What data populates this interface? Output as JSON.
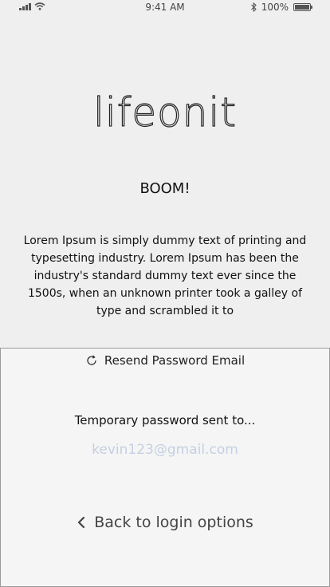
{
  "status_bar": {
    "time": "9:41 AM",
    "battery_text": "100%",
    "icons": [
      "signal-icon",
      "wifi-icon",
      "bluetooth-icon",
      "battery-icon"
    ]
  },
  "logo": {
    "text": "lifeonit"
  },
  "headline": "BOOM!",
  "body": "Lorem Ipsum is simply dummy text of printing and typesetting industry. Lorem Ipsum has been the industry's standard dummy text ever since the 1500s, when an unknown printer took a galley of type and scrambled it to",
  "panel": {
    "resend_label": "Resend Password Email",
    "temp_label": "Temporary password sent to...",
    "email": "kevin123@gmail.com",
    "back_label": "Back to login options"
  },
  "colors": {
    "background": "#efefef",
    "panel_background": "#f5f5f5",
    "email_text": "#c5cfe2"
  }
}
